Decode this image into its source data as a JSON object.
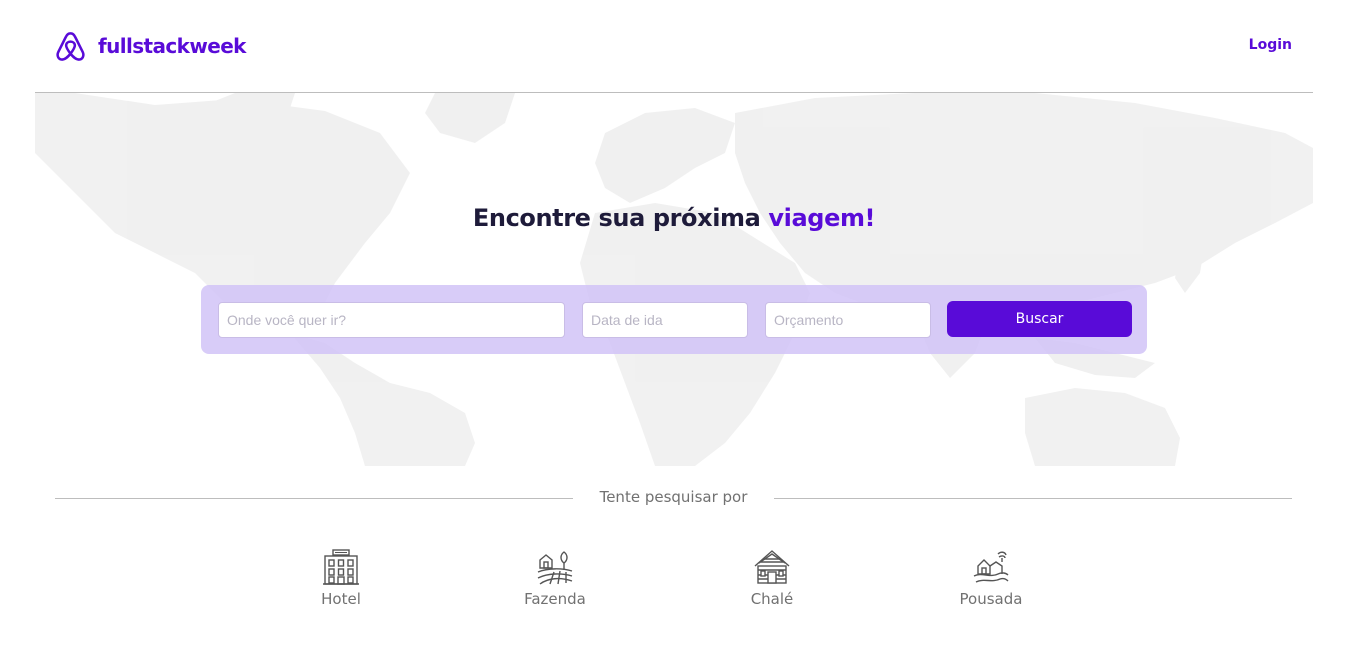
{
  "brand": {
    "name": "fullstackweek",
    "color": "#590bd8"
  },
  "header": {
    "login_label": "Login"
  },
  "hero": {
    "headline": "Encontre sua próxima",
    "headline_accent": "viagem!"
  },
  "search": {
    "destination_placeholder": "Onde você quer ir?",
    "date_placeholder": "Data de ida",
    "budget_placeholder": "Orçamento",
    "button_label": "Buscar"
  },
  "suggestions": {
    "title": "Tente pesquisar por",
    "items": [
      {
        "label": "Hotel",
        "icon": "hotel-icon"
      },
      {
        "label": "Fazenda",
        "icon": "farm-icon"
      },
      {
        "label": "Chalé",
        "icon": "chalet-icon"
      },
      {
        "label": "Pousada",
        "icon": "inn-icon"
      }
    ]
  },
  "colors": {
    "primary": "#590bd8",
    "search_panel": "#d1c3f7",
    "text_dark": "#1e1b3a",
    "text_muted": "#717171"
  }
}
